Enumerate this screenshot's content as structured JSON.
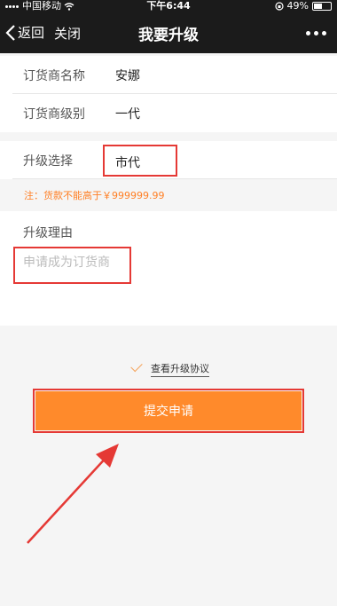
{
  "status_bar": {
    "carrier": "中国移动",
    "time": "下午6:44",
    "battery": "49%",
    "battery_level": 0.49
  },
  "nav": {
    "back_label": "返回",
    "close_label": "关闭",
    "title": "我要升级"
  },
  "info": {
    "name_label": "订货商名称",
    "name_value": "安娜",
    "level_label": "订货商级别",
    "level_value": "一代"
  },
  "upgrade": {
    "choice_label": "升级选择",
    "choice_value": "市代",
    "note": "注：货款不能高于￥999999.99"
  },
  "reason": {
    "label": "升级理由",
    "placeholder": "申请成为订货商"
  },
  "agreement": {
    "checked": true,
    "link_label": "查看升级协议"
  },
  "submit": {
    "label": "提交申请"
  },
  "colors": {
    "accent": "#ff8a2b",
    "annotation": "#e53935"
  }
}
